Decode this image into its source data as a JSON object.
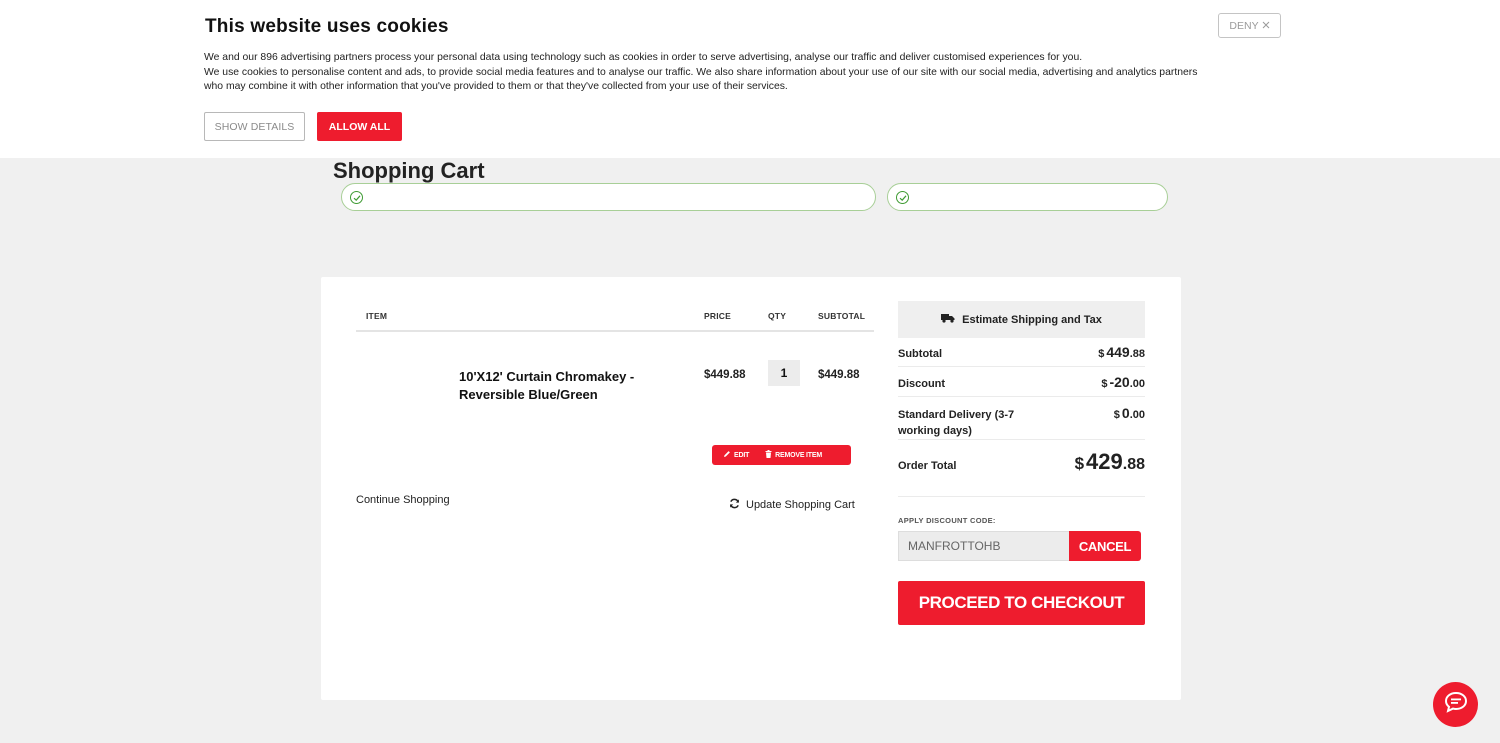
{
  "cookie_banner": {
    "title": "This website uses cookies",
    "line1": "We and our 896 advertising partners process your personal data using technology such as cookies in order to serve advertising, analyse our traffic and deliver customised experiences for you.",
    "line2": "We use cookies to personalise content and ads, to provide social media features and to analyse our traffic. We also share information about your use of our site with our social media, advertising and analytics partners",
    "line3": "who may combine it with other information that you've provided to them or that they've collected from your use of their services.",
    "deny_label": "DENY",
    "show_details_label": "SHOW DETAILS",
    "allow_all_label": "ALLOW ALL"
  },
  "page": {
    "title": "Shopping Cart"
  },
  "cart": {
    "headers": {
      "item": "ITEM",
      "price": "PRICE",
      "qty": "QTY",
      "subtotal": "SUBTOTAL"
    },
    "items": [
      {
        "name_line1": "10'X12' Curtain Chromakey -",
        "name_line2": "Reversible Blue/Green",
        "price": "$449.88",
        "qty": "1",
        "subtotal": "$449.88",
        "edit_label": "EDIT",
        "remove_label": "REMOVE ITEM"
      }
    ],
    "continue_label": "Continue Shopping",
    "update_label": "Update Shopping Cart"
  },
  "summary": {
    "estimate_label": "Estimate Shipping and Tax",
    "subtotal": {
      "label": "Subtotal",
      "currency": "$",
      "whole": "449",
      "cents": ".88"
    },
    "discount": {
      "label": "Discount",
      "currency": "$",
      "whole": "-20",
      "cents": ".00"
    },
    "delivery": {
      "label_line1": "Standard Delivery (3-7",
      "label_line2": "working days)",
      "currency": "$",
      "whole": "0",
      "cents": ".00"
    },
    "total": {
      "label": "Order Total",
      "currency": "$",
      "whole": "429",
      "cents": ".88"
    },
    "discount_code": {
      "label": "APPLY DISCOUNT CODE:",
      "value": "MANFROTTOHB",
      "cancel_label": "CANCEL"
    },
    "checkout_label": "PROCEED TO CHECKOUT"
  },
  "colors": {
    "accent": "#ee1c2e",
    "success": "#3f9b33"
  },
  "icons": [
    "close-icon",
    "check-icon",
    "truck-icon",
    "pencil-icon",
    "trash-icon",
    "refresh-icon",
    "chat-icon"
  ]
}
